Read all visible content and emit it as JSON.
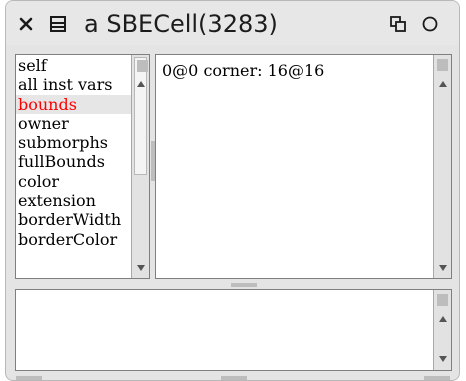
{
  "window": {
    "title": "a SBECell(3283)"
  },
  "icons": {
    "close": "close-icon",
    "menu": "window-menu-icon",
    "collapse": "collapse-icon",
    "expand": "expand-icon"
  },
  "field_list": {
    "items": [
      "self",
      "all inst vars",
      "bounds",
      "owner",
      "submorphs",
      "fullBounds",
      "color",
      "extension",
      "borderWidth",
      "borderColor"
    ],
    "selected_index": 2
  },
  "value_pane": {
    "text": "0@0 corner: 16@16"
  },
  "eval_pane": {
    "text": ""
  },
  "colors": {
    "selection_text": "#ff0000",
    "window_bg": "#e4e4e4"
  }
}
